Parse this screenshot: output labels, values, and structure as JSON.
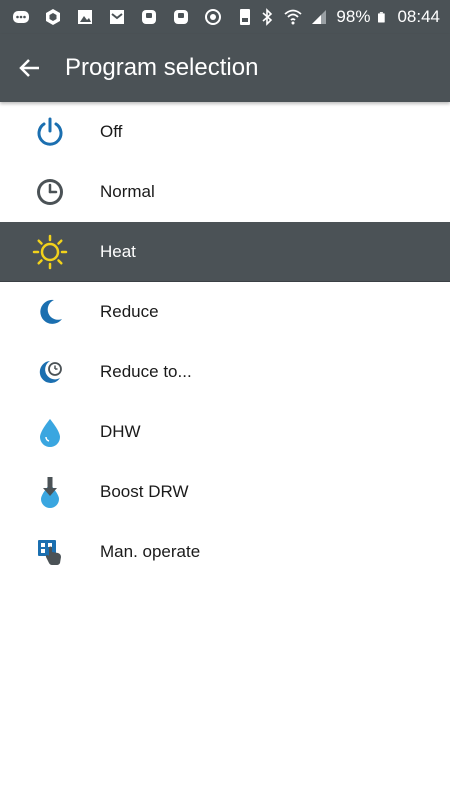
{
  "status_bar": {
    "battery": "98%",
    "time": "08:44"
  },
  "app_bar": {
    "title": "Program selection"
  },
  "programs": [
    {
      "label": "Off",
      "icon": "power-icon",
      "selected": false
    },
    {
      "label": "Normal",
      "icon": "clock-icon",
      "selected": false
    },
    {
      "label": "Heat",
      "icon": "sun-icon",
      "selected": true
    },
    {
      "label": "Reduce",
      "icon": "moon-icon",
      "selected": false
    },
    {
      "label": "Reduce to...",
      "icon": "moon-clock-icon",
      "selected": false
    },
    {
      "label": "DHW",
      "icon": "water-drop-icon",
      "selected": false
    },
    {
      "label": "Boost DRW",
      "icon": "boost-drop-icon",
      "selected": false
    },
    {
      "label": "Man. operate",
      "icon": "manual-operate-icon",
      "selected": false
    }
  ],
  "colors": {
    "bar": "#4b5256",
    "accent_blue": "#1b6fb0",
    "sun_yellow": "#f2d21b",
    "drop_light_blue": "#3aa6e0"
  }
}
